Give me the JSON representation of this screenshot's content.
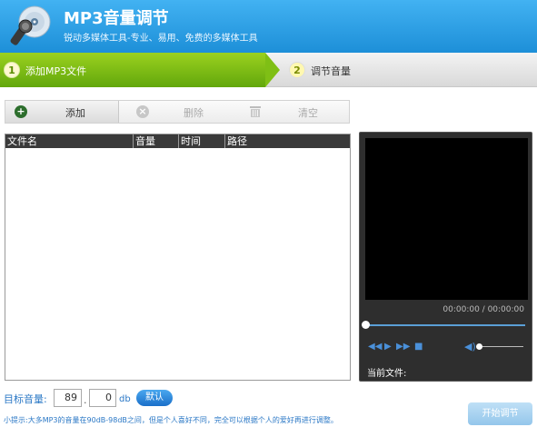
{
  "header": {
    "title": "MP3音量调节",
    "subtitle": "锐动多媒体工具-专业、易用、免费的多媒体工具"
  },
  "steps": [
    {
      "number": "1",
      "label": "添加MP3文件",
      "active": true
    },
    {
      "number": "2",
      "label": "调节音量",
      "active": false
    }
  ],
  "toolbar": {
    "add_label": "添加",
    "delete_label": "删除",
    "clear_label": "清空"
  },
  "table": {
    "columns": [
      "文件名",
      "音量",
      "时间",
      "路径"
    ],
    "rows": []
  },
  "player": {
    "time": "00:00:00 / 00:00:00",
    "current_file_label": "当前文件:"
  },
  "volume": {
    "label": "目标音量:",
    "integer_value": "89",
    "decimal_value": "0",
    "separator": ".",
    "unit": "db",
    "default_button": "默认"
  },
  "tip": "小提示:大多MP3的音量在90dB-98dB之间，但是个人喜好不同，完全可以根据个人的爱好再进行调整。",
  "start_button": "开始调节",
  "colors": {
    "header_blue": "#2a9ee6",
    "step_green": "#7fbf15",
    "link_blue": "#2b78c6"
  }
}
